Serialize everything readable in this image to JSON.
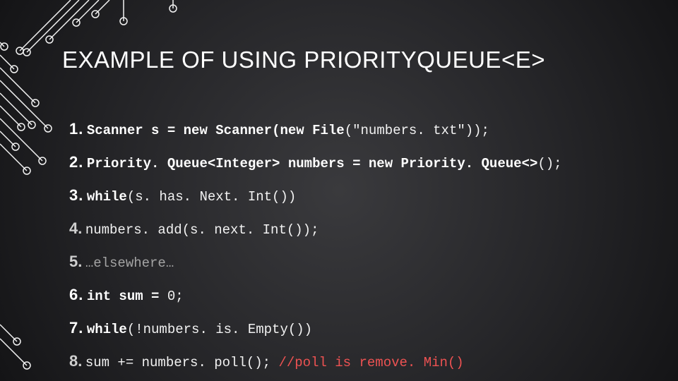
{
  "title": "EXAMPLE OF USING PRIORITYQUEUE<E>",
  "lines": {
    "n1": "1.",
    "n2": "2.",
    "n3": "3.",
    "n4": "4.",
    "n5": "5.",
    "n6": "6.",
    "n7": "7.",
    "n8": "8.",
    "l1a": "Scanner s = ",
    "l1b": "new",
    "l1c": " Scanner(",
    "l1d": "new",
    "l1e": " File",
    "l1f": "(\"numbers. txt\"));",
    "l2a": "Priority. Queue<Integer> numbers = ",
    "l2b": "new",
    "l2c": " Priority. Queue<>",
    "l2d": "();",
    "l3a": "while",
    "l3b": "(s. has. Next. Int())",
    "l4a": " numbers. add(s. next. Int());",
    "l5a": "…elsewhere…",
    "l6a": "int",
    "l6b": " sum = ",
    "l6c": "0;",
    "l7a": "while",
    "l7b": "(!numbers. is. Empty())",
    "l8a": " sum += numbers. poll(); ",
    "l8b": "//poll is remove. Min()"
  }
}
